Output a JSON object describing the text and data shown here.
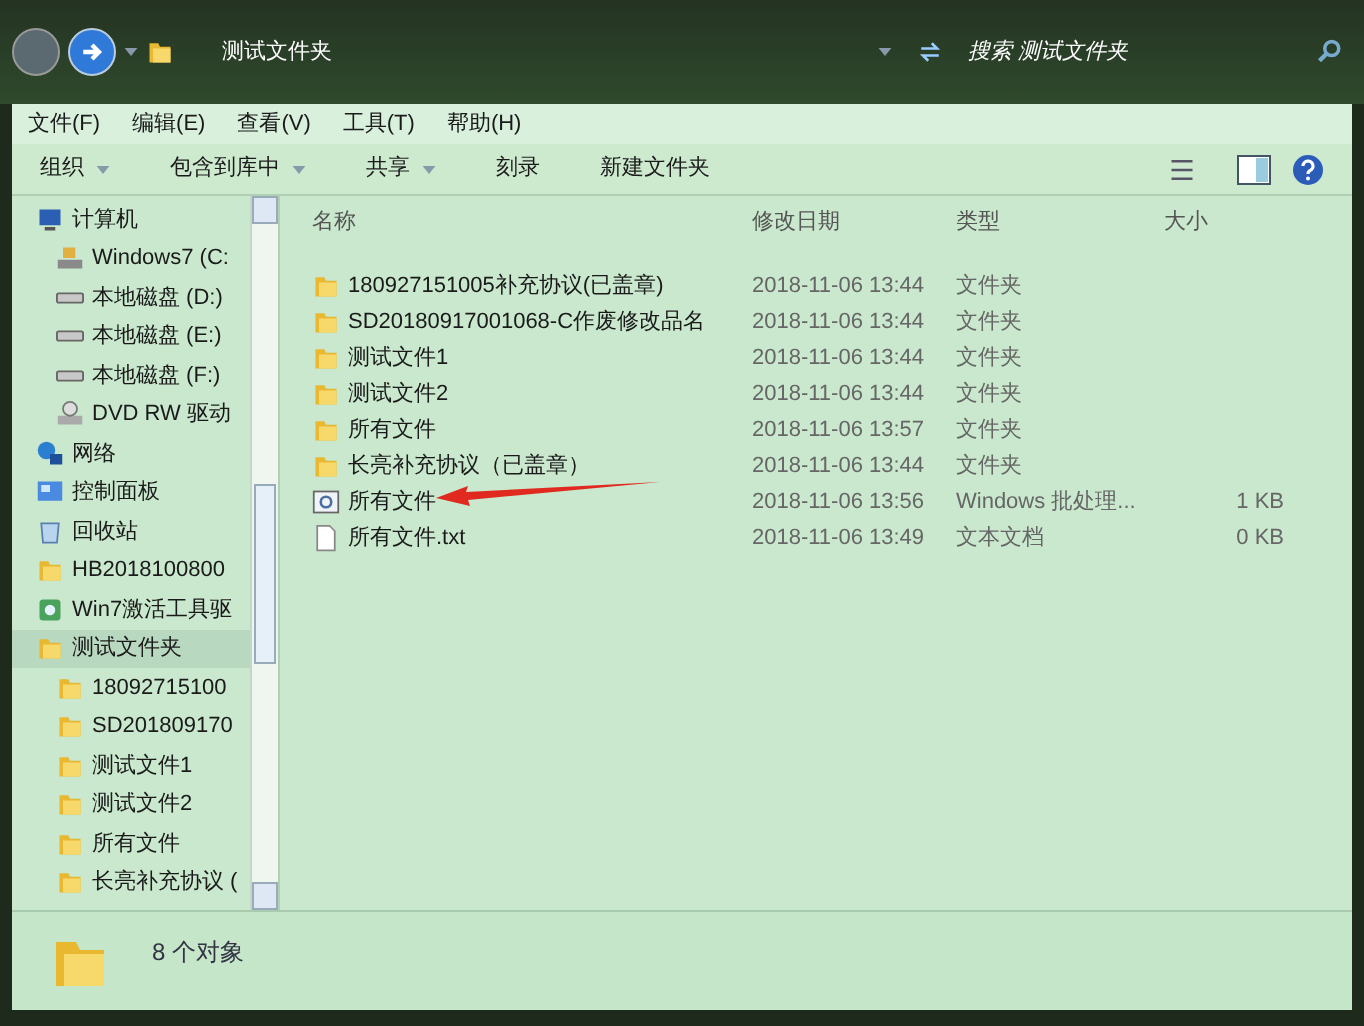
{
  "address_bar": {
    "path": "测试文件夹"
  },
  "search": {
    "placeholder": "搜索 测试文件夹"
  },
  "menu": [
    "文件(F)",
    "编辑(E)",
    "查看(V)",
    "工具(T)",
    "帮助(H)"
  ],
  "toolbar": [
    {
      "label": "组织",
      "has_menu": true
    },
    {
      "label": "包含到库中",
      "has_menu": true
    },
    {
      "label": "共享",
      "has_menu": true
    },
    {
      "label": "刻录",
      "has_menu": false
    },
    {
      "label": "新建文件夹",
      "has_menu": false
    }
  ],
  "sidebar": {
    "items": [
      {
        "label": "计算机",
        "kind": "computer",
        "selected": false,
        "children": [
          {
            "label": "Windows7 (C:",
            "kind": "system-drive",
            "selected": false
          },
          {
            "label": "本地磁盘 (D:)",
            "kind": "drive",
            "selected": false
          },
          {
            "label": "本地磁盘 (E:)",
            "kind": "drive",
            "selected": false
          },
          {
            "label": "本地磁盘 (F:)",
            "kind": "drive",
            "selected": false
          },
          {
            "label": "DVD RW 驱动",
            "kind": "dvd",
            "selected": false
          }
        ]
      },
      {
        "label": "网络",
        "kind": "network",
        "selected": false
      },
      {
        "label": "控制面板",
        "kind": "control-panel",
        "selected": false
      },
      {
        "label": "回收站",
        "kind": "recycle",
        "selected": false
      },
      {
        "label": "HB2018100800",
        "kind": "folder",
        "selected": false
      },
      {
        "label": "Win7激活工具驱",
        "kind": "app",
        "selected": false
      },
      {
        "label": "测试文件夹",
        "kind": "folder",
        "selected": true,
        "children": [
          {
            "label": "18092715100",
            "kind": "folder",
            "selected": false
          },
          {
            "label": "SD201809170",
            "kind": "folder",
            "selected": false
          },
          {
            "label": "测试文件1",
            "kind": "folder",
            "selected": false
          },
          {
            "label": "测试文件2",
            "kind": "folder",
            "selected": false
          },
          {
            "label": "所有文件",
            "kind": "folder",
            "selected": false
          },
          {
            "label": "长亮补充协议 (",
            "kind": "folder",
            "selected": false
          }
        ]
      }
    ]
  },
  "table": {
    "columns": [
      "名称",
      "修改日期",
      "类型",
      "大小"
    ],
    "rows": [
      {
        "name": "180927151005补充协议(已盖章)",
        "date": "2018-11-06 13:44",
        "type": "文件夹",
        "kind": "folder"
      },
      {
        "name": "SD20180917001068-C作废修改品名",
        "date": "2018-11-06 13:44",
        "type": "文件夹",
        "kind": "folder"
      },
      {
        "name": "测试文件1",
        "date": "2018-11-06 13:44",
        "type": "文件夹",
        "kind": "folder"
      },
      {
        "name": "测试文件2",
        "date": "2018-11-06 13:44",
        "type": "文件夹",
        "kind": "folder"
      },
      {
        "name": "所有文件",
        "date": "2018-11-06 13:57",
        "type": "文件夹",
        "kind": "folder"
      },
      {
        "name": "长亮补充协议（已盖章）",
        "date": "2018-11-06 13:44",
        "type": "文件夹",
        "kind": "folder"
      },
      {
        "name": "所有文件",
        "date": "2018-11-06 13:56",
        "type": "Windows 批处理...",
        "size": "1 KB",
        "kind": "batch"
      },
      {
        "name": "所有文件.txt",
        "date": "2018-11-06 13:49",
        "type": "文本文档",
        "size": "0 KB",
        "kind": "text"
      }
    ]
  },
  "status_bar": {
    "text": "8 个对象"
  }
}
